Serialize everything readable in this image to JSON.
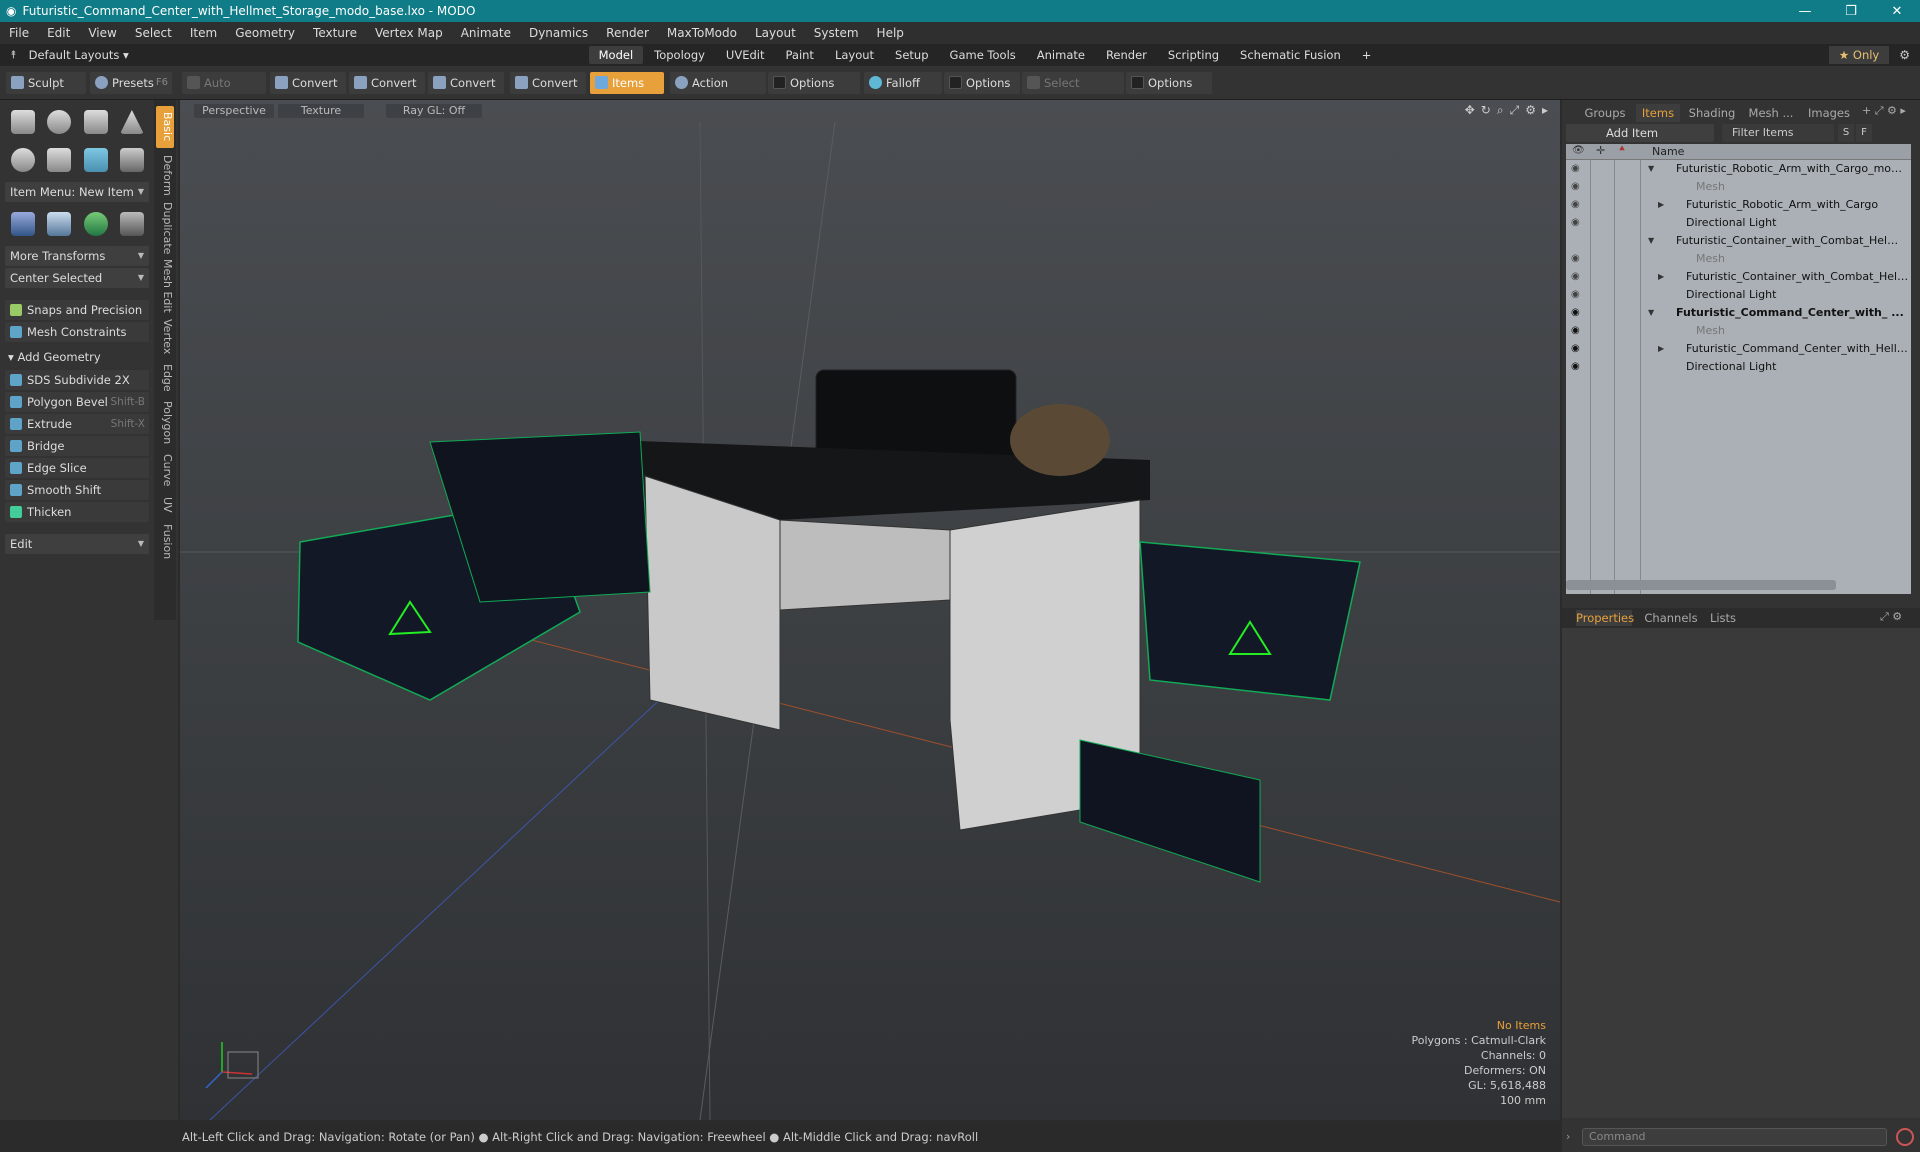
{
  "window": {
    "title": "Futuristic_Command_Center_with_Hellmet_Storage_modo_base.lxo - MODO",
    "minimize": "—",
    "maximize": "❐",
    "close": "✕"
  },
  "menu": [
    "File",
    "Edit",
    "View",
    "Select",
    "Item",
    "Geometry",
    "Texture",
    "Vertex Map",
    "Animate",
    "Dynamics",
    "Render",
    "MaxToModo",
    "Layout",
    "System",
    "Help"
  ],
  "layouts": {
    "selector": "Default Layouts ▾",
    "tabs": [
      "Model",
      "Topology",
      "UVEdit",
      "Paint",
      "Layout",
      "Setup",
      "Game Tools",
      "Animate",
      "Render",
      "Scripting",
      "Schematic Fusion"
    ],
    "active": "Model",
    "plus": "+",
    "only": "★ Only"
  },
  "toolbar": {
    "sculpt": "Sculpt",
    "presets": "Presets",
    "presets_key": "F6",
    "auto_select": "Auto Select",
    "convert1": "Convert",
    "convert2": "Convert",
    "convert3": "Convert",
    "convert4": "Convert",
    "items": "Items",
    "action_center": "Action Center",
    "options1": "Options",
    "falloff": "Falloff",
    "options2": "Options",
    "select_through": "Select Through",
    "options3": "Options"
  },
  "left": {
    "vtabs": [
      "Basic",
      "Deform",
      "Duplicate",
      "Mesh Edit",
      "Vertex",
      "Edge",
      "Polygon",
      "Curve",
      "UV",
      "Fusion"
    ],
    "item_menu": "Item Menu: New Item",
    "more_transforms": "More Transforms",
    "center_selected": "Center Selected",
    "snaps": "Snaps and Precision",
    "mesh_constraints": "Mesh Constraints",
    "add_geometry": "Add Geometry",
    "tools": [
      {
        "label": "SDS Subdivide 2X",
        "key": ""
      },
      {
        "label": "Polygon Bevel",
        "key": "Shift-B"
      },
      {
        "label": "Extrude",
        "key": "Shift-X"
      },
      {
        "label": "Bridge",
        "key": ""
      },
      {
        "label": "Edge Slice",
        "key": ""
      },
      {
        "label": "Smooth Shift",
        "key": ""
      },
      {
        "label": "Thicken",
        "key": ""
      }
    ],
    "edit": "Edit"
  },
  "viewport": {
    "perspective": "Perspective",
    "texture": "Texture",
    "raygl": "Ray GL: Off",
    "stats": {
      "no_items": "No Items",
      "polygons": "Polygons : Catmull-Clark",
      "channels": "Channels: 0",
      "deformers": "Deformers: ON",
      "gl": "GL: 5,618,488",
      "scale": "100 mm"
    }
  },
  "status": "Alt-Left Click and Drag: Navigation: Rotate (or Pan) ● Alt-Right Click and Drag: Navigation: Freewheel ● Alt-Middle Click and Drag: navRoll",
  "right": {
    "tabs": [
      "Groups",
      "Items",
      "Shading",
      "Mesh ...",
      "Images"
    ],
    "active": "Items",
    "add_item": "Add Item",
    "filter": "Filter Items",
    "s": "S",
    "f": "F",
    "col_name": "Name",
    "items": [
      {
        "name": "Futuristic_Robotic_Arm_with_Cargo_modo ...",
        "level": 0,
        "type": "scene"
      },
      {
        "name": "Mesh",
        "level": 1,
        "type": "mesh"
      },
      {
        "name": "Futuristic_Robotic_Arm_with_Cargo",
        "level": 1,
        "type": "item"
      },
      {
        "name": "Directional Light",
        "level": 1,
        "type": "light"
      },
      {
        "name": "Futuristic_Container_with_Combat_Helmet ...",
        "level": 0,
        "type": "scene"
      },
      {
        "name": "Mesh",
        "level": 1,
        "type": "mesh"
      },
      {
        "name": "Futuristic_Container_with_Combat_Helm...",
        "level": 1,
        "type": "item"
      },
      {
        "name": "Directional Light",
        "level": 1,
        "type": "light"
      },
      {
        "name": "Futuristic_Command_Center_with_ ...",
        "level": 0,
        "type": "scene",
        "bold": true
      },
      {
        "name": "Mesh",
        "level": 1,
        "type": "mesh"
      },
      {
        "name": "Futuristic_Command_Center_with_Hellm ...",
        "level": 1,
        "type": "item"
      },
      {
        "name": "Directional Light",
        "level": 1,
        "type": "light"
      }
    ],
    "prop_tabs": [
      "Properties",
      "Channels",
      "Lists"
    ],
    "prop_active": "Properties",
    "command_placeholder": "Command"
  }
}
